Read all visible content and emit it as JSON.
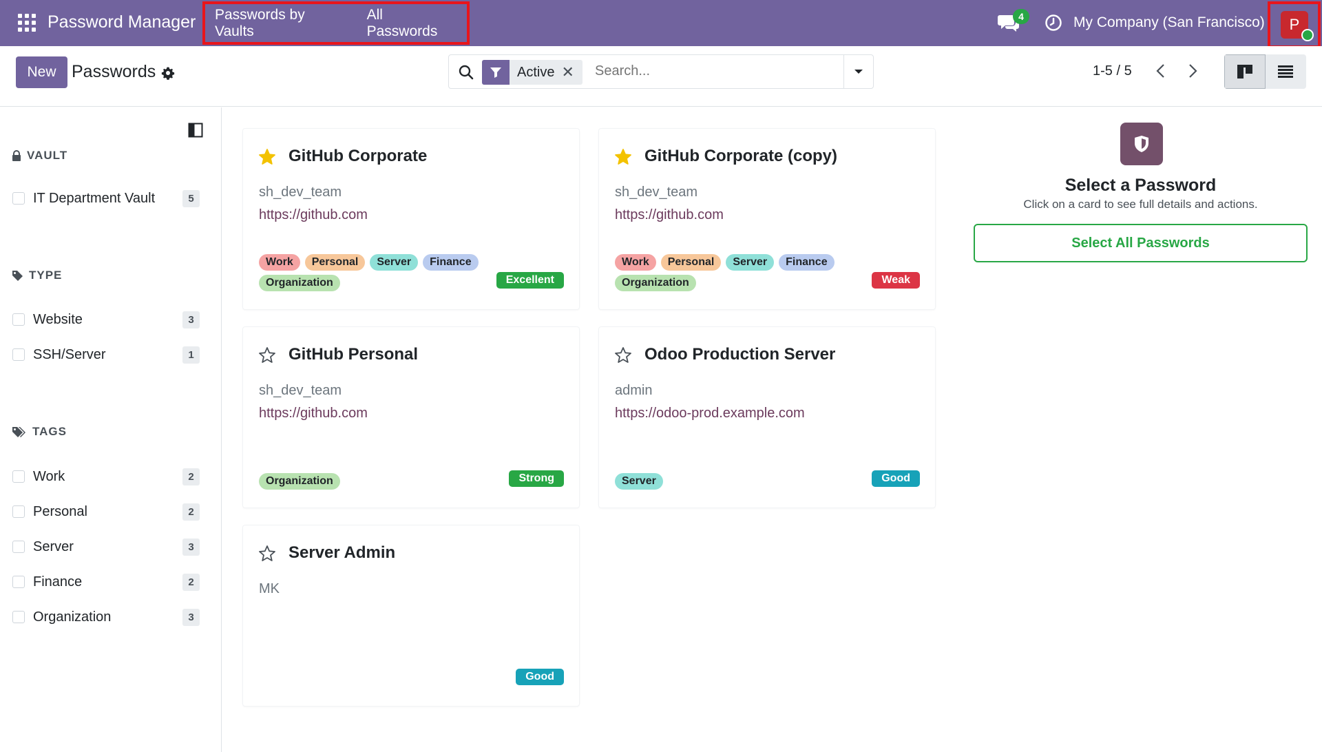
{
  "navbar": {
    "brand": "Password Manager",
    "menu": [
      "Passwords by Vaults",
      "All Passwords"
    ],
    "chat_count": "4",
    "company": "My Company (San Francisco)",
    "avatar_initial": "P"
  },
  "control": {
    "new_label": "New",
    "title": "Passwords",
    "facet_label": "Active",
    "facet_remove": "✕",
    "search_placeholder": "Search...",
    "pager": "1-5 / 5"
  },
  "sidebar": {
    "vault_heading": "VAULT",
    "vaults": [
      {
        "label": "IT Department Vault",
        "count": "5"
      }
    ],
    "type_heading": "TYPE",
    "types": [
      {
        "label": "Website",
        "count": "3"
      },
      {
        "label": "SSH/Server",
        "count": "1"
      }
    ],
    "tags_heading": "TAGS",
    "tags": [
      {
        "label": "Work",
        "count": "2"
      },
      {
        "label": "Personal",
        "count": "2"
      },
      {
        "label": "Server",
        "count": "3"
      },
      {
        "label": "Finance",
        "count": "2"
      },
      {
        "label": "Organization",
        "count": "3"
      }
    ]
  },
  "cards": [
    {
      "title": "GitHub Corporate",
      "login": "sh_dev_team",
      "url": "https://github.com",
      "favorite": true,
      "tags": [
        "Work",
        "Personal",
        "Server",
        "Finance",
        "Organization"
      ],
      "strength": "Excellent",
      "strength_color": "#28a745"
    },
    {
      "title": "GitHub Corporate (copy)",
      "login": "sh_dev_team",
      "url": "https://github.com",
      "favorite": true,
      "tags": [
        "Work",
        "Personal",
        "Server",
        "Finance",
        "Organization"
      ],
      "strength": "Weak",
      "strength_color": "#dc3545"
    },
    {
      "title": "GitHub Personal",
      "login": "sh_dev_team",
      "url": "https://github.com",
      "favorite": false,
      "tags": [
        "Organization"
      ],
      "strength": "Strong",
      "strength_color": "#28a745"
    },
    {
      "title": "Odoo Production Server",
      "login": "admin",
      "url": "https://odoo-prod.example.com",
      "favorite": false,
      "tags": [
        "Server"
      ],
      "strength": "Good",
      "strength_color": "#17a2b8"
    },
    {
      "title": "Server Admin",
      "login": "MK",
      "url": "",
      "favorite": false,
      "tags": [],
      "strength": "Good",
      "strength_color": "#17a2b8"
    }
  ],
  "detail": {
    "title": "Select a Password",
    "subtitle": "Click on a card to see full details and actions.",
    "select_all_label": "Select All Passwords"
  },
  "colors": {
    "brand": "#71639e",
    "highlight": "#e8151b",
    "star": "#f3c200"
  }
}
